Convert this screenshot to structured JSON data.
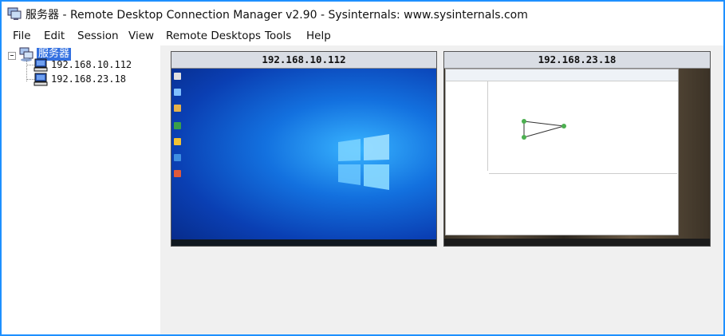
{
  "window": {
    "title": "服务器 - Remote Desktop Connection Manager v2.90 - Sysinternals: www.sysinternals.com"
  },
  "menu": [
    "File",
    "Edit",
    "Session",
    "View",
    "Remote Desktops",
    "Tools",
    "Help"
  ],
  "tree": {
    "root_label": "服务器",
    "servers": [
      {
        "label": "192.168.10.112"
      },
      {
        "label": "192.168.23.18"
      }
    ]
  },
  "thumbnails": [
    {
      "header": "192.168.10.112"
    },
    {
      "header": "192.168.23.18"
    }
  ],
  "colors": {
    "accent": "#1e90ff",
    "selection": "#3370e0",
    "main_bg": "#f0f0f0",
    "thumb_header_bg": "#d9dde4"
  }
}
